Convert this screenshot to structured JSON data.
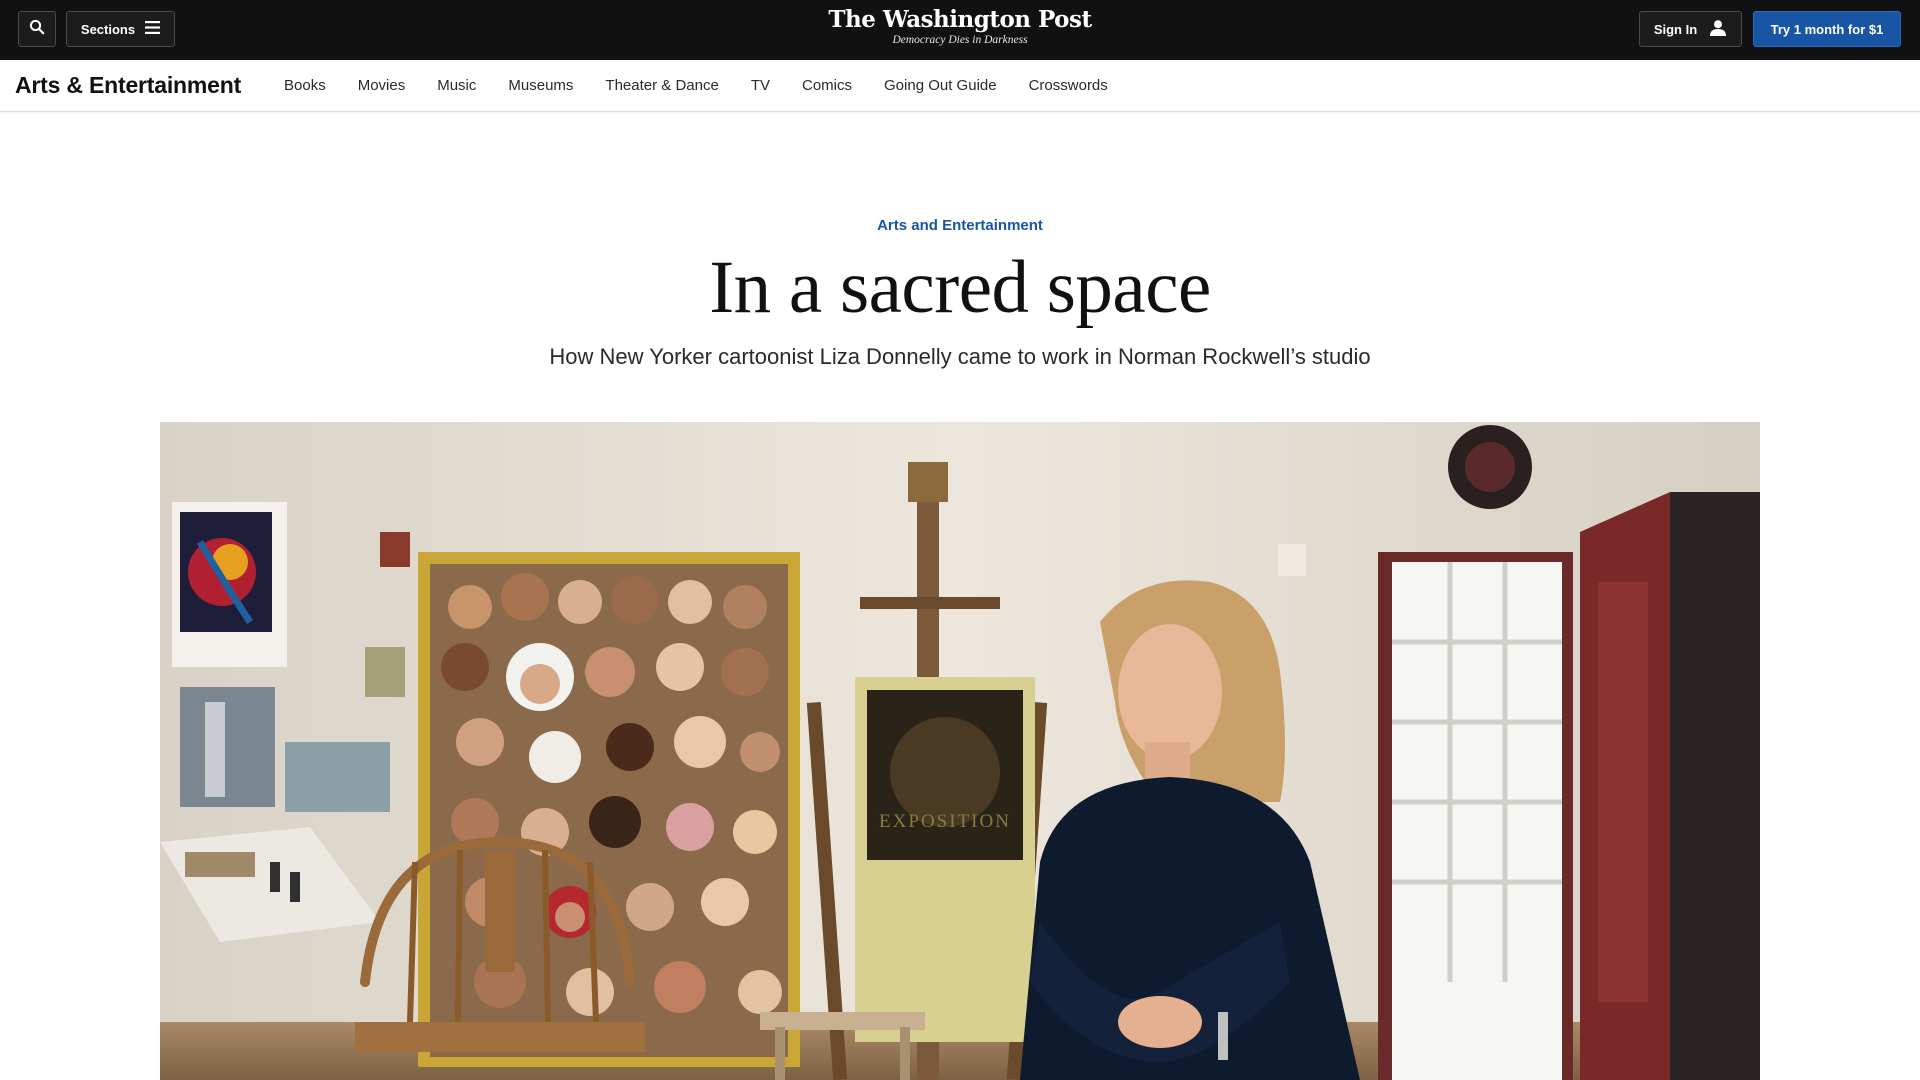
{
  "header": {
    "search_icon": "search-icon",
    "sections_label": "Sections",
    "sections_icon": "hamburger-menu-icon",
    "brand_name": "The Washington Post",
    "brand_tagline": "Democracy Dies in Darkness",
    "signin_label": "Sign In",
    "signin_icon": "user-icon",
    "trial_label": "Try 1 month for $1",
    "colors": {
      "bar_bg": "#111111",
      "accent_blue": "#1955a5"
    }
  },
  "section_nav": {
    "title": "Arts & Entertainment",
    "links": [
      "Books",
      "Movies",
      "Music",
      "Museums",
      "Theater & Dance",
      "TV",
      "Comics",
      "Going Out Guide",
      "Crosswords"
    ]
  },
  "article": {
    "kicker": "Arts and Entertainment",
    "headline": "In a sacred space",
    "dek": "How New Yorker cartoonist Liza Donnelly came to work in Norman Rockwell’s studio",
    "hero_image": {
      "poster_text": "EXPOSITION"
    }
  }
}
